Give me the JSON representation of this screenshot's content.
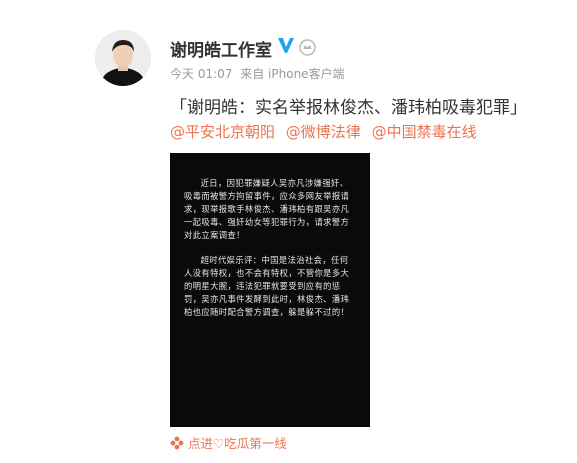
{
  "post": {
    "author": "谢明皓工作室",
    "time": "今天 01:07",
    "source": "来自 iPhone客户端",
    "headline": "「谢明皓：实名举报林俊杰、潘玮柏吸毒犯罪」",
    "mentions": [
      "@平安北京朝阳",
      "@微博法律",
      "@中国禁毒在线"
    ],
    "image_text": {
      "p1": "近日，因犯罪嫌疑人吴亦凡涉嫌强奸、吸毒而被警方拘留事件，应众多网友举报请求，现举报歌手林俊杰、潘玮柏有跟吴亦凡一起吸毒、强奸幼女等犯罪行为，请求警方对此立案调查！",
      "p2": "超时代娱乐评：中国是法治社会，任何人没有特权，也不会有特权，不管你是多大的明星大腕，违法犯罪就要受到应有的惩罚，吴亦凡事件发酵到此时，林俊杰、潘玮柏也应随时配合警方调查，躲是躲不过的！"
    },
    "footer_link": "点进♡吃瓜第一线"
  },
  "colors": {
    "link": "#eb7350",
    "verified": "#1da1f2",
    "meta": "#9b9b9b"
  },
  "icons": [
    "verified-v-icon",
    "member-badge-icon",
    "flower-icon"
  ]
}
